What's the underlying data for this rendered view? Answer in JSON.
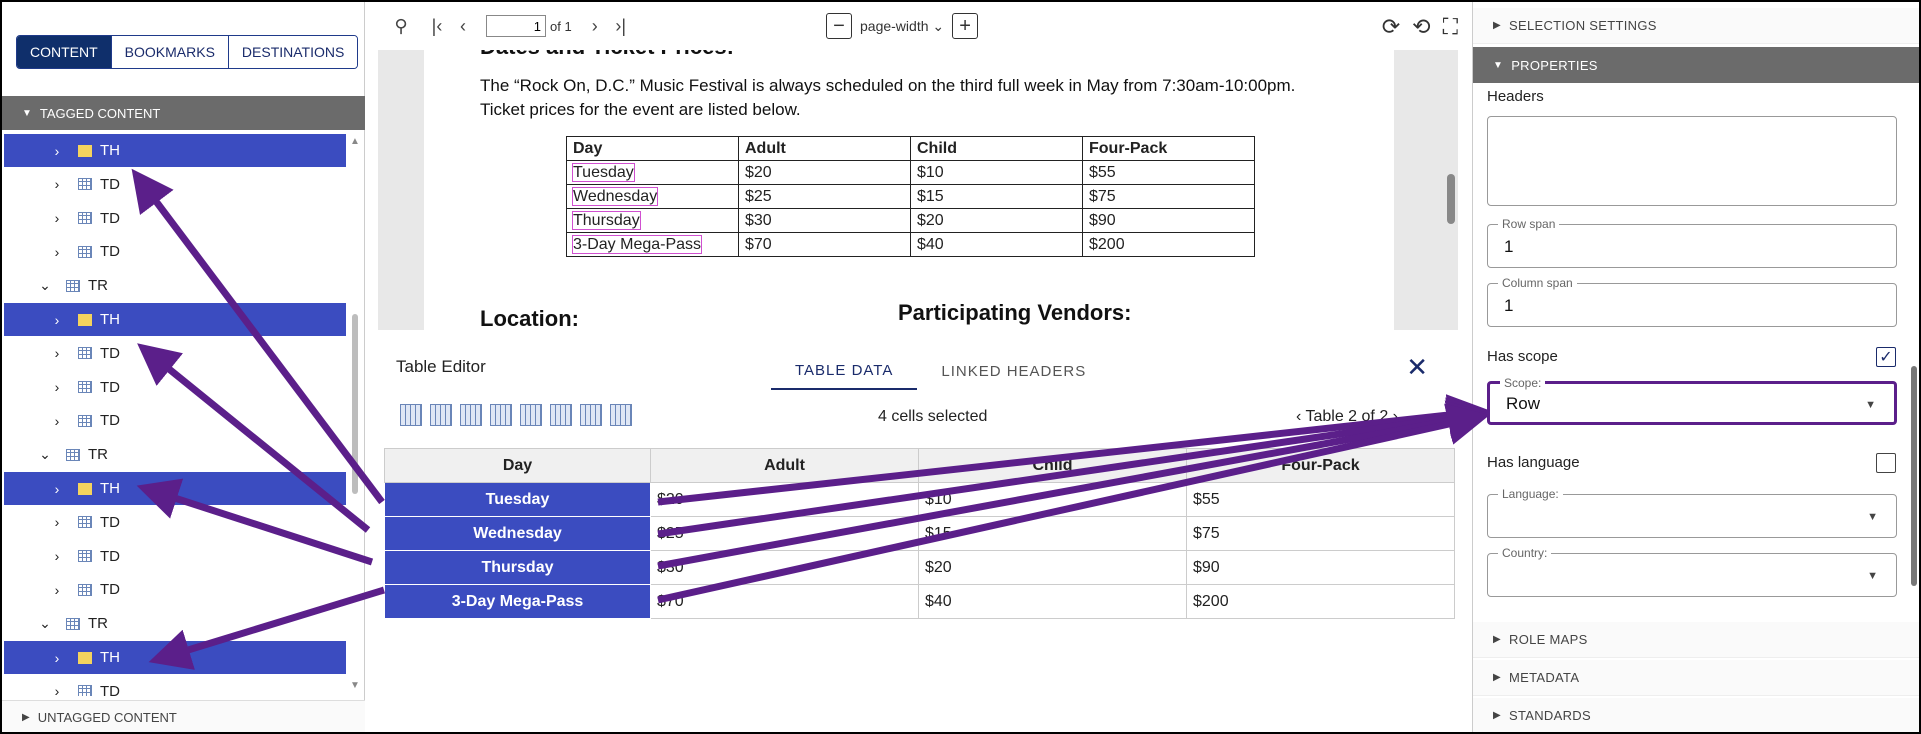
{
  "left_panel": {
    "tabs": [
      "CONTENT",
      "BOOKMARKS",
      "DESTINATIONS"
    ],
    "tagged_header": "TAGGED CONTENT",
    "untagged_header": "UNTAGGED CONTENT",
    "tree": [
      {
        "label": "TH",
        "expand": ">",
        "selected": true,
        "type": "th"
      },
      {
        "label": "TD",
        "expand": ">",
        "selected": false,
        "type": "td"
      },
      {
        "label": "TD",
        "expand": ">",
        "selected": false,
        "type": "td"
      },
      {
        "label": "TD",
        "expand": ">",
        "selected": false,
        "type": "td"
      },
      {
        "label": "TR",
        "expand": "v",
        "selected": false,
        "type": "tr"
      },
      {
        "label": "TH",
        "expand": ">",
        "selected": true,
        "type": "th"
      },
      {
        "label": "TD",
        "expand": ">",
        "selected": false,
        "type": "td"
      },
      {
        "label": "TD",
        "expand": ">",
        "selected": false,
        "type": "td"
      },
      {
        "label": "TD",
        "expand": ">",
        "selected": false,
        "type": "td"
      },
      {
        "label": "TR",
        "expand": "v",
        "selected": false,
        "type": "tr"
      },
      {
        "label": "TH",
        "expand": ">",
        "selected": true,
        "type": "th"
      },
      {
        "label": "TD",
        "expand": ">",
        "selected": false,
        "type": "td"
      },
      {
        "label": "TD",
        "expand": ">",
        "selected": false,
        "type": "td"
      },
      {
        "label": "TD",
        "expand": ">",
        "selected": false,
        "type": "td"
      },
      {
        "label": "TR",
        "expand": "v",
        "selected": false,
        "type": "tr"
      },
      {
        "label": "TH",
        "expand": ">",
        "selected": true,
        "type": "th"
      },
      {
        "label": "TD",
        "expand": ">",
        "selected": false,
        "type": "td"
      }
    ]
  },
  "viewer": {
    "page_value": "1",
    "page_of": "of 1",
    "zoom": "page-width",
    "heading_top": "Dates and Ticket Prices:",
    "para1": "The “Rock On, D.C.” Music Festival is always scheduled on the third full week in May from 7:30am-10:00pm.",
    "para2": "Ticket prices for the event are listed below.",
    "table_headers": [
      "Day",
      "Adult",
      "Child",
      "Four-Pack"
    ],
    "table_rows": [
      [
        "Tuesday",
        "$20",
        "$10",
        "$55"
      ],
      [
        "Wednesday",
        "$25",
        "$15",
        "$75"
      ],
      [
        "Thursday",
        "$30",
        "$20",
        "$90"
      ],
      [
        "3-Day Mega-Pass",
        "$70",
        "$40",
        "$200"
      ]
    ],
    "location_heading": "Location:",
    "vendors_heading": "Participating Vendors:"
  },
  "editor": {
    "title": "Table Editor",
    "tabs": [
      "TABLE DATA",
      "LINKED HEADERS"
    ],
    "cells_selected": "4 cells selected",
    "table_nav": "Table 2 of 2",
    "headers": [
      "Day",
      "Adult",
      "Child",
      "Four-Pack"
    ],
    "rows": [
      [
        "Tuesday",
        "$20",
        "$10",
        "$55"
      ],
      [
        "Wednesday",
        "$25",
        "$15",
        "$75"
      ],
      [
        "Thursday",
        "$30",
        "$20",
        "$90"
      ],
      [
        "3-Day  Mega-Pass",
        "$70",
        "$40",
        "$200"
      ]
    ]
  },
  "right_panel": {
    "selection_settings": "SELECTION SETTINGS",
    "properties": "PROPERTIES",
    "headers_label": "Headers",
    "row_span_label": "Row span",
    "row_span_value": "1",
    "col_span_label": "Column span",
    "col_span_value": "1",
    "has_scope_label": "Has scope",
    "has_scope_checked": true,
    "scope_label": "Scope:",
    "scope_value": "Row",
    "has_language_label": "Has language",
    "has_language_checked": false,
    "language_label": "Language:",
    "country_label": "Country:",
    "role_maps": "ROLE MAPS",
    "metadata": "METADATA",
    "standards": "STANDARDS"
  },
  "colors": {
    "selection": "#3b4cc0",
    "arrow": "#5b1f8a",
    "navy": "#0f2f6b"
  }
}
